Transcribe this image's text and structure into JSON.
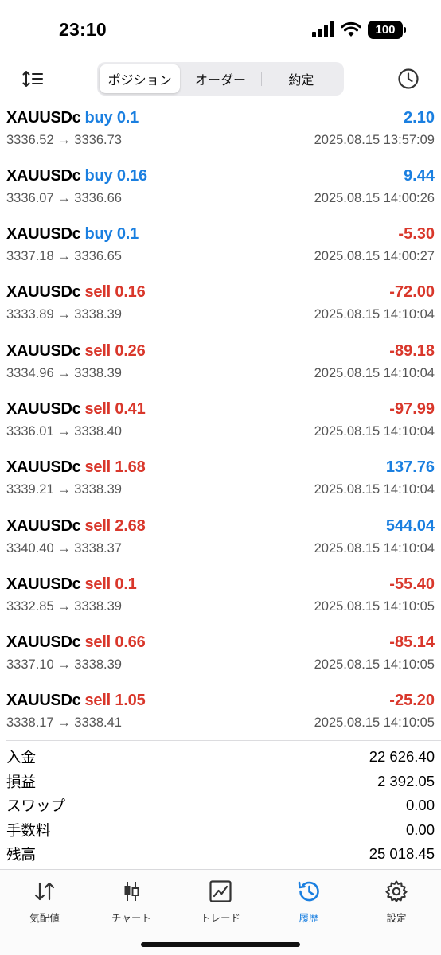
{
  "status": {
    "time": "23:10",
    "battery": "100"
  },
  "toolbar": {
    "tabs": [
      {
        "label": "ポジション",
        "active": true
      },
      {
        "label": "オーダー",
        "active": false
      },
      {
        "label": "約定",
        "active": false
      }
    ]
  },
  "deals": [
    {
      "symbol": "XAUUSDc",
      "type": "buy",
      "volume": "0.1",
      "prices": "3336.52 → 3336.73",
      "profit": "2.10",
      "time": "2025.08.15 13:57:09"
    },
    {
      "symbol": "XAUUSDc",
      "type": "buy",
      "volume": "0.16",
      "prices": "3336.07 → 3336.66",
      "profit": "9.44",
      "time": "2025.08.15 14:00:26"
    },
    {
      "symbol": "XAUUSDc",
      "type": "buy",
      "volume": "0.1",
      "prices": "3337.18 → 3336.65",
      "profit": "-5.30",
      "time": "2025.08.15 14:00:27"
    },
    {
      "symbol": "XAUUSDc",
      "type": "sell",
      "volume": "0.16",
      "prices": "3333.89 → 3338.39",
      "profit": "-72.00",
      "time": "2025.08.15 14:10:04"
    },
    {
      "symbol": "XAUUSDc",
      "type": "sell",
      "volume": "0.26",
      "prices": "3334.96 → 3338.39",
      "profit": "-89.18",
      "time": "2025.08.15 14:10:04"
    },
    {
      "symbol": "XAUUSDc",
      "type": "sell",
      "volume": "0.41",
      "prices": "3336.01 → 3338.40",
      "profit": "-97.99",
      "time": "2025.08.15 14:10:04"
    },
    {
      "symbol": "XAUUSDc",
      "type": "sell",
      "volume": "1.68",
      "prices": "3339.21 → 3338.39",
      "profit": "137.76",
      "time": "2025.08.15 14:10:04"
    },
    {
      "symbol": "XAUUSDc",
      "type": "sell",
      "volume": "2.68",
      "prices": "3340.40 → 3338.37",
      "profit": "544.04",
      "time": "2025.08.15 14:10:04"
    },
    {
      "symbol": "XAUUSDc",
      "type": "sell",
      "volume": "0.1",
      "prices": "3332.85 → 3338.39",
      "profit": "-55.40",
      "time": "2025.08.15 14:10:05"
    },
    {
      "symbol": "XAUUSDc",
      "type": "sell",
      "volume": "0.66",
      "prices": "3337.10 → 3338.39",
      "profit": "-85.14",
      "time": "2025.08.15 14:10:05"
    },
    {
      "symbol": "XAUUSDc",
      "type": "sell",
      "volume": "1.05",
      "prices": "3338.17 → 3338.41",
      "profit": "-25.20",
      "time": "2025.08.15 14:10:05"
    }
  ],
  "summary": [
    {
      "label": "入金",
      "value": "22 626.40"
    },
    {
      "label": "損益",
      "value": "2 392.05"
    },
    {
      "label": "スワップ",
      "value": "0.00"
    },
    {
      "label": "手数料",
      "value": "0.00"
    },
    {
      "label": "残高",
      "value": "25 018.45"
    }
  ],
  "tabbar": [
    {
      "label": "気配値",
      "icon": "quotes-arrows-icon",
      "active": false
    },
    {
      "label": "チャート",
      "icon": "candlestick-chart-icon",
      "active": false
    },
    {
      "label": "トレード",
      "icon": "trade-line-chart-icon",
      "active": false
    },
    {
      "label": "履歴",
      "icon": "history-clock-icon",
      "active": true
    },
    {
      "label": "設定",
      "icon": "gear-icon",
      "active": false
    }
  ],
  "colors": {
    "buy": "#1a7fe0",
    "sell": "#d9372b",
    "active_tab": "#1a7fe0"
  }
}
